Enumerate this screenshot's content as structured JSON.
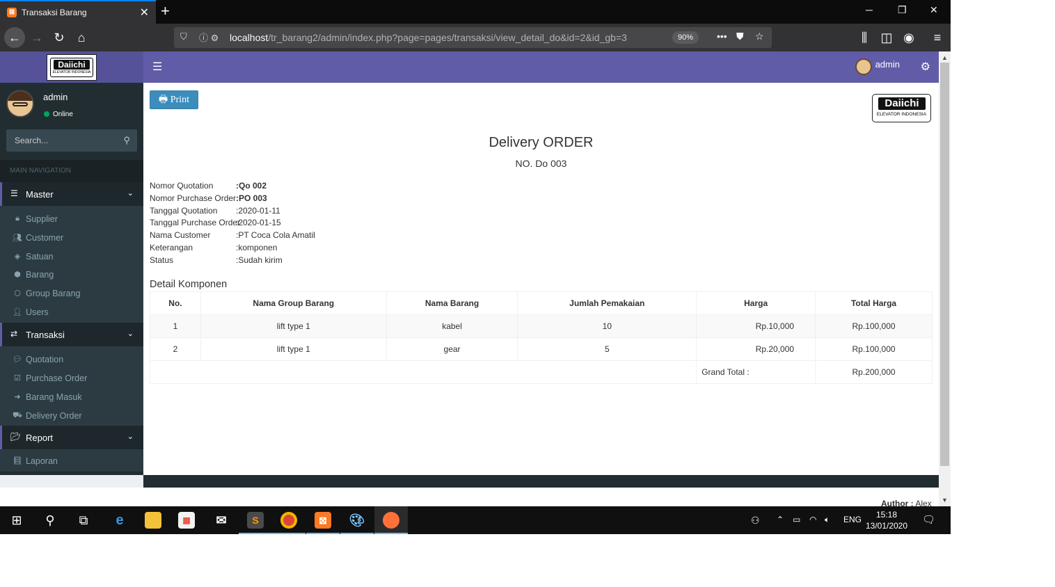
{
  "browser": {
    "tab_title": "Transaksi Barang",
    "url_host": "localhost",
    "url_path": "/tr_barang2/admin/index.php?page=pages/transaksi/view_detail_do&id=2&id_gb=3",
    "zoom": "90%"
  },
  "header": {
    "logo_brand": "Daiichi",
    "logo_sub": "ELEVATOR INDONESIA",
    "user_name": "admin"
  },
  "sidebar": {
    "user_name": "admin",
    "user_status": "Online",
    "search_placeholder": "Search...",
    "nav_header": "MAIN NAVIGATION",
    "groups": [
      {
        "label": "Master",
        "items": [
          "Supplier",
          "Customer",
          "Satuan",
          "Barang",
          "Group Barang",
          "Users"
        ]
      },
      {
        "label": "Transaksi",
        "items": [
          "Quotation",
          "Purchase Order",
          "Barang Masuk",
          "Delivery Order"
        ]
      },
      {
        "label": "Report",
        "items": [
          "Laporan"
        ]
      }
    ]
  },
  "content": {
    "print_label": "Print",
    "title": "Delivery ORDER",
    "number": "NO. Do 003",
    "info": [
      {
        "label": "Nomor Quotation",
        "value": ":Qo 002"
      },
      {
        "label": "Nomor Purchase Order",
        "value": ":PO 003"
      },
      {
        "label": "Tanggal Quotation",
        "value": ":2020-01-11"
      },
      {
        "label": "Tanggal Purchase Order",
        "value": ":2020-01-15"
      },
      {
        "label": "Nama Customer",
        "value": ":PT Coca Cola Amatil"
      },
      {
        "label": "Keterangan",
        "value": ":komponen"
      },
      {
        "label": "Status",
        "value": ":Sudah kirim"
      }
    ],
    "section_title": "Detail Komponen",
    "table": {
      "headers": [
        "No.",
        "Nama Group Barang",
        "Nama Barang",
        "Jumlah Pemakaian",
        "Harga",
        "Total Harga"
      ],
      "rows": [
        [
          "1",
          "lift type 1",
          "kabel",
          "10",
          "Rp.10,000",
          "Rp.100,000"
        ],
        [
          "2",
          "lift type 1",
          "gear",
          "5",
          "Rp.20,000",
          "Rp.100,000"
        ]
      ],
      "grand_total_label": "Grand Total :",
      "grand_total_value": "Rp.200,000"
    },
    "author_label": "Author :",
    "author_name": "Alex"
  },
  "taskbar": {
    "language": "ENG",
    "time": "15:18",
    "date": "13/01/2020"
  },
  "colors": {
    "header_purple": "#605ca8",
    "logo_purple": "#555299",
    "sidebar_dark": "#222d32",
    "print_blue": "#3c8dbc"
  }
}
